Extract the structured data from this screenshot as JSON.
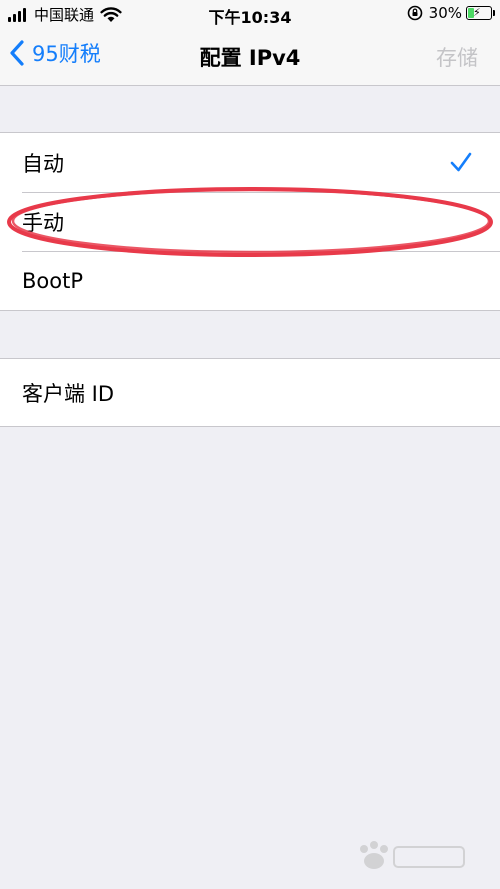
{
  "status_bar": {
    "carrier": "中国联通",
    "time": "下午10:34",
    "battery_percent": "30%",
    "battery_level": 0.3,
    "icons": [
      "signal-icon",
      "wifi-icon",
      "orientation-lock-icon",
      "battery-charging-icon"
    ]
  },
  "nav": {
    "back_label": "95财税",
    "title": "配置 IPv4",
    "save_label": "存储"
  },
  "options": {
    "items": [
      {
        "label": "自动",
        "selected": true
      },
      {
        "label": "手动",
        "selected": false
      },
      {
        "label": "BootP",
        "selected": false
      }
    ]
  },
  "client": {
    "label": "客户端 ID"
  },
  "annotation": {
    "color": "#e83a4a",
    "target": "手动"
  },
  "colors": {
    "accent": "#147efb",
    "disabled": "#c4c4c7",
    "background": "#efeff4"
  }
}
